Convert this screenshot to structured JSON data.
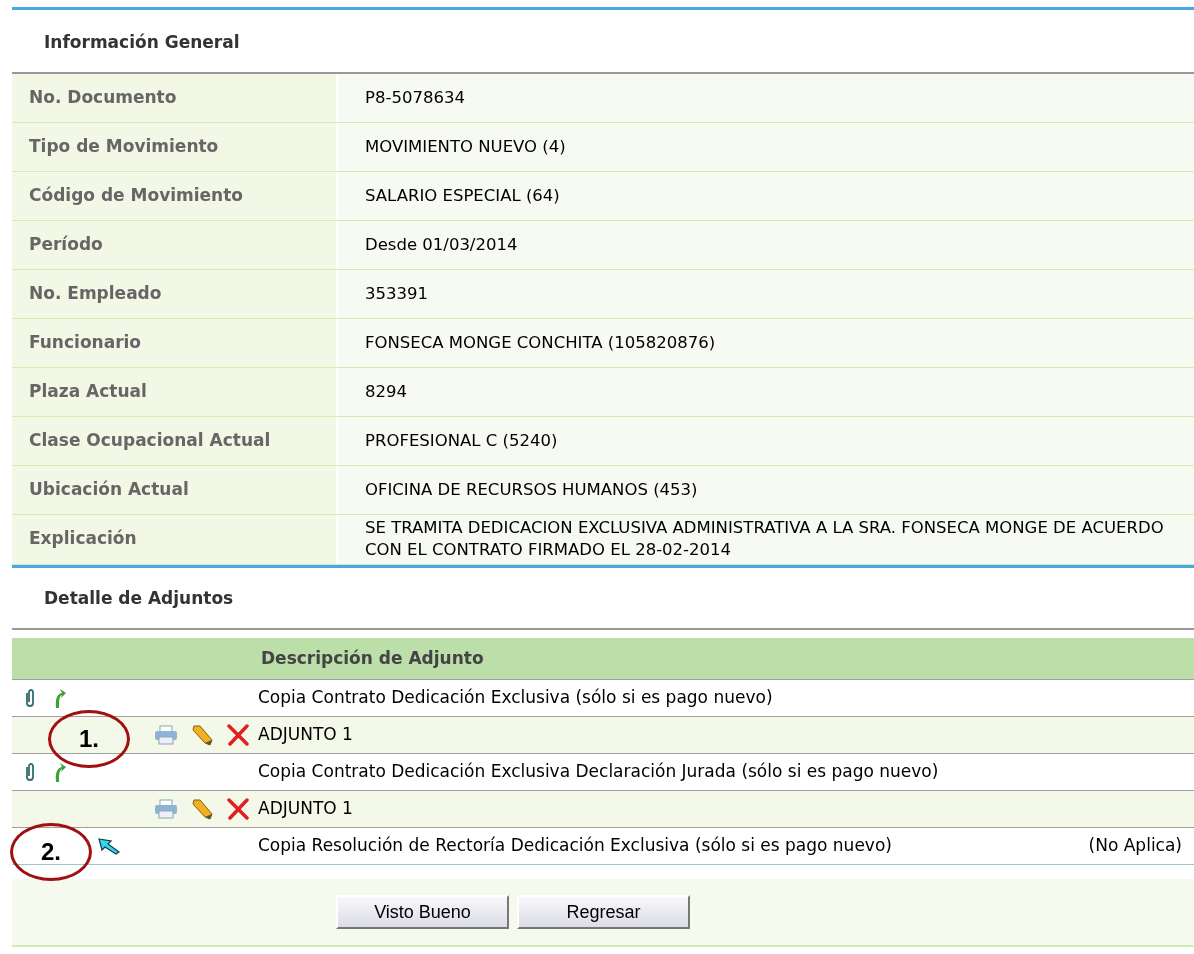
{
  "general": {
    "title": "Información General",
    "rows": [
      {
        "label": "No. Documento",
        "value": "P8-5078634"
      },
      {
        "label": "Tipo de Movimiento",
        "value": "MOVIMIENTO NUEVO (4)"
      },
      {
        "label": "Código de Movimiento",
        "value": "SALARIO ESPECIAL (64)"
      },
      {
        "label": "Período",
        "value": "Desde 01/03/2014"
      },
      {
        "label": "No. Empleado",
        "value": "353391"
      },
      {
        "label": "Funcionario",
        "value": "FONSECA MONGE CONCHITA (105820876)"
      },
      {
        "label": "Plaza Actual",
        "value": "8294"
      },
      {
        "label": "Clase Ocupacional Actual",
        "value": "PROFESIONAL C (5240)"
      },
      {
        "label": "Ubicación Actual",
        "value": "OFICINA DE RECURSOS HUMANOS (453)"
      },
      {
        "label": "Explicación",
        "value": "SE TRAMITA DEDICACION EXCLUSIVA ADMINISTRATIVA A LA SRA. FONSECA MONGE DE ACUERDO CON EL CONTRATO FIRMADO EL 28-02-2014"
      }
    ]
  },
  "attachments": {
    "title": "Detalle de Adjuntos",
    "column": "Descripción de Adjunto",
    "rows": [
      {
        "kind": "document",
        "text": "Copia Contrato Dedicación Exclusiva (sólo si es pago nuevo)"
      },
      {
        "kind": "file",
        "text": "ADJUNTO 1",
        "annotation": "1."
      },
      {
        "kind": "document",
        "text": "Copia Contrato Dedicación Exclusiva Declaración Jurada (sólo si es pago nuevo)"
      },
      {
        "kind": "file",
        "text": "ADJUNTO 1"
      },
      {
        "kind": "pending",
        "text": "Copia Resolución de Rectoría Dedicación Exclusiva (sólo si es pago nuevo)",
        "status": "(No Aplica)",
        "annotation": "2."
      }
    ]
  },
  "buttons": [
    "Visto Bueno",
    "Regresar"
  ]
}
